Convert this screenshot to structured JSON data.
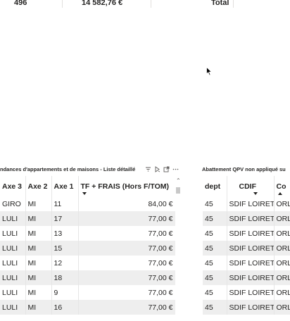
{
  "top_row": {
    "count": "496",
    "amount": "14 582,76 €",
    "total_label": "Total"
  },
  "left_visual": {
    "title": "ndances d'appartements et de maisons - Liste détaillé",
    "columns": [
      {
        "label": "Axe 3"
      },
      {
        "label": "Axe 2"
      },
      {
        "label": "Axe 1"
      },
      {
        "label": "TF + FRAIS (Hors F/TOM)"
      }
    ],
    "rows": [
      [
        "GIRO",
        "MI",
        "11",
        "84,00 €"
      ],
      [
        "LULI",
        "MI",
        "17",
        "77,00 €"
      ],
      [
        "LULI",
        "MI",
        "13",
        "77,00 €"
      ],
      [
        "LULI",
        "MI",
        "15",
        "77,00 €"
      ],
      [
        "LULI",
        "MI",
        "12",
        "77,00 €"
      ],
      [
        "LULI",
        "MI",
        "18",
        "77,00 €"
      ],
      [
        "LULI",
        "MI",
        "9",
        "77,00 €"
      ],
      [
        "LULI",
        "MI",
        "16",
        "77,00 €"
      ]
    ],
    "icons": [
      "filter-icon",
      "pin-icon",
      "focus-mode-icon",
      "more-options-icon"
    ]
  },
  "right_visual": {
    "title": "Abattement QPV non appliqué su",
    "columns": [
      {
        "label": "dept"
      },
      {
        "label": "CDIF"
      },
      {
        "label": "Co"
      }
    ],
    "rows": [
      [
        "45",
        "SDIF LOIRET",
        "ORL"
      ],
      [
        "45",
        "SDIF LOIRET",
        "ORL"
      ],
      [
        "45",
        "SDIF LOIRET",
        "ORL"
      ],
      [
        "45",
        "SDIF LOIRET",
        "ORL"
      ],
      [
        "45",
        "SDIF LOIRET",
        "ORL"
      ],
      [
        "45",
        "SDIF LOIRET",
        "ORL"
      ],
      [
        "45",
        "SDIF LOIRET",
        "ORL"
      ],
      [
        "45",
        "SDIF LOIRET",
        "ORL"
      ]
    ]
  },
  "colors": {
    "row_alt": "#eeeeee",
    "text": "#252423",
    "grid": "#e6e6e6"
  }
}
